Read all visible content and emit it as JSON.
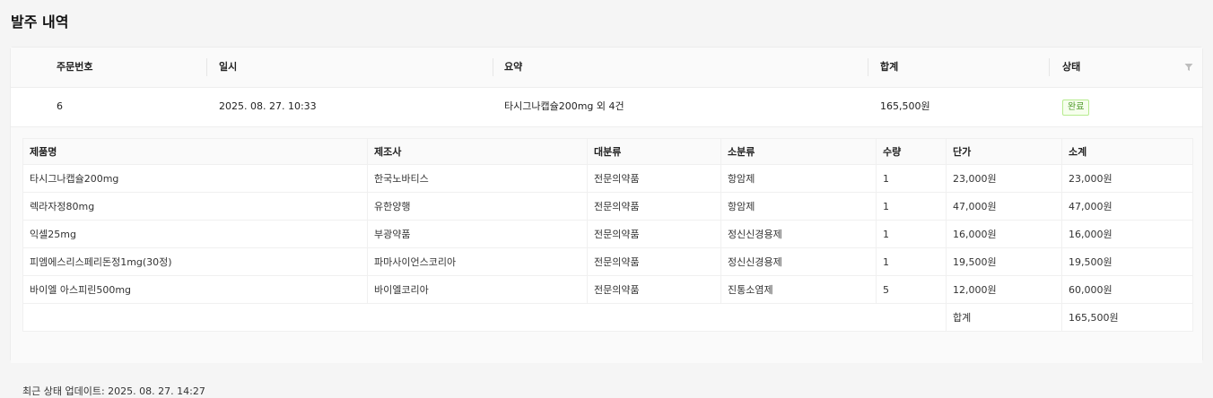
{
  "page": {
    "title": "발주 내역"
  },
  "orders_table": {
    "headers": {
      "order_no": "주문번호",
      "date": "일시",
      "summary": "요약",
      "total": "합계",
      "status": "상태"
    },
    "row": {
      "order_no": "6",
      "date": "2025. 08. 27. 10:33",
      "summary": "타시그나캡슐200mg 외 4건",
      "total": "165,500원",
      "status": "완료"
    },
    "filter_icon": "filter-icon"
  },
  "detail_table": {
    "headers": [
      "제품명",
      "제조사",
      "대분류",
      "소분류",
      "수량",
      "단가",
      "소계"
    ],
    "rows": [
      [
        "타시그나캡슐200mg",
        "한국노바티스",
        "전문의약품",
        "항암제",
        "1",
        "23,000원",
        "23,000원"
      ],
      [
        "렉라자정80mg",
        "유한양행",
        "전문의약품",
        "항암제",
        "1",
        "47,000원",
        "47,000원"
      ],
      [
        "익셀25mg",
        "부광약품",
        "전문의약품",
        "정신신경용제",
        "1",
        "16,000원",
        "16,000원"
      ],
      [
        "피엠에스리스페리돈정1mg(30정)",
        "파마사이언스코리아",
        "전문의약품",
        "정신신경용제",
        "1",
        "19,500원",
        "19,500원"
      ],
      [
        "바이엘 아스피린500mg",
        "바이엘코리아",
        "전문의약품",
        "진통소염제",
        "5",
        "12,000원",
        "60,000원"
      ]
    ],
    "footer": {
      "label": "합계",
      "value": "165,500원"
    }
  },
  "last_update": "최근 상태 업데이트: 2025. 08. 27. 14:27",
  "colors": {
    "badge_text": "#4f9a2a",
    "badge_bg": "#f6ffed",
    "badge_border": "#b7eb8f"
  }
}
